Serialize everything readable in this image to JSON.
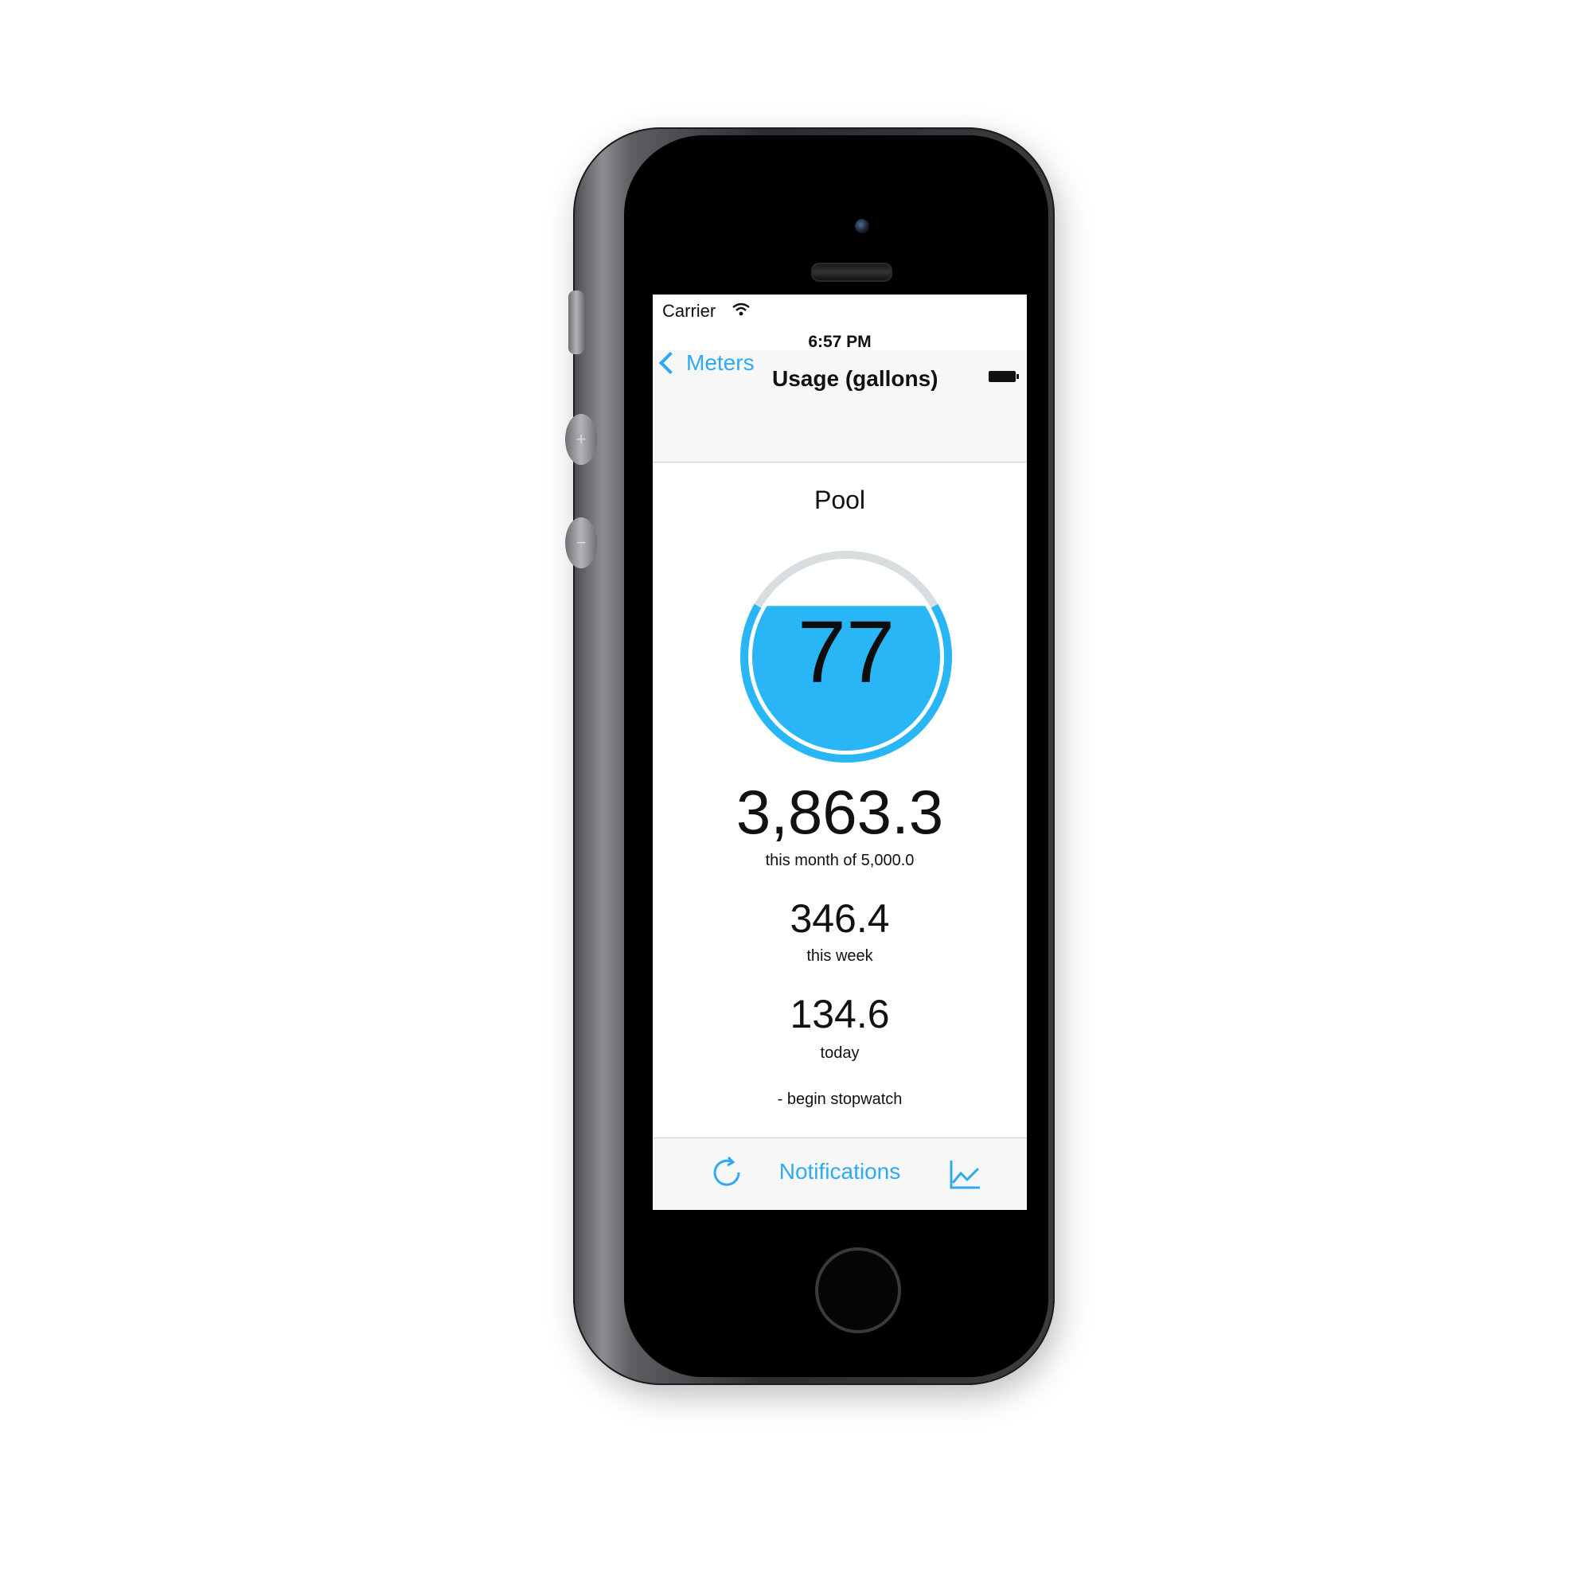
{
  "status_bar": {
    "carrier": "Carrier",
    "time": "6:57 PM",
    "wifi_icon": "wifi-icon",
    "battery_icon": "battery-icon"
  },
  "nav_bar": {
    "back_label": "Meters",
    "title": "Usage (gallons)"
  },
  "meter": {
    "name": "Pool",
    "gauge_value": "77",
    "gauge_fill_fraction": 0.77,
    "month_value": "3,863.3",
    "month_caption": "this month of 5,000.0",
    "week_value": "346.4",
    "week_caption": "this week",
    "today_value": "134.6",
    "today_caption": "today",
    "stopwatch_label": "-  begin stopwatch"
  },
  "toolbar": {
    "refresh_icon": "refresh-icon",
    "notifications_label": "Notifications",
    "chart_icon": "line-chart-icon"
  },
  "colors": {
    "accent": "#2fa9f2",
    "gauge_fill": "#29b6f6",
    "gauge_ring": "#d8dde0",
    "phone_body": "#3c3c40"
  }
}
